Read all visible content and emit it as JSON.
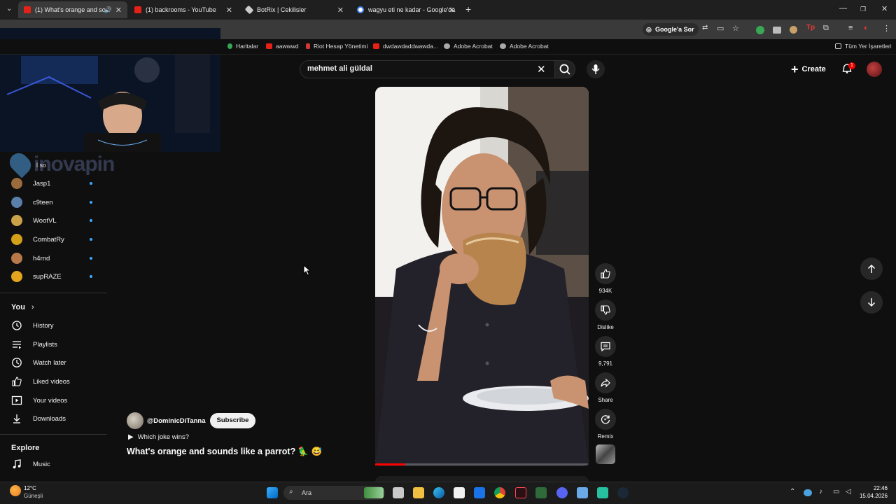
{
  "browser": {
    "tabs": [
      {
        "title": "(1) What's orange and sou",
        "active": true,
        "favicon_color": "#e62117"
      },
      {
        "title": "(1) backrooms - YouTube",
        "active": false,
        "favicon_color": "#e62117"
      },
      {
        "title": "BotRix | Cekilisler",
        "active": false,
        "favicon_color": "#cccccc"
      },
      {
        "title": "wagyu eti ne kadar - Google'da",
        "active": false,
        "favicon_color": "#4285f4"
      }
    ],
    "ask_google_label": "Google'a Sor",
    "bookmarks": [
      {
        "label": "Haritalar",
        "color": "#34a853"
      },
      {
        "label": "aawwwd",
        "color": "#e62117"
      },
      {
        "label": "Riot Hesap Yönetimi",
        "color": "#d13639"
      },
      {
        "label": "dwdawdaddwawda...",
        "color": "#e62117"
      },
      {
        "label": "Adobe Acrobat",
        "color": "#aaaaaa"
      },
      {
        "label": "Adobe Acrobat",
        "color": "#aaaaaa"
      }
    ],
    "all_bookmarks_label": "Tüm Yer İşaretleri"
  },
  "youtube": {
    "search_value": "mehmet ali güldal",
    "create_label": "Create",
    "notification_count": "1"
  },
  "overlay": {
    "watermark_text": "inovapin",
    "clipped_sidebar_text": "l so"
  },
  "sidebar": {
    "subscriptions": [
      {
        "name": "Jasp1",
        "color": "#9c6b3c"
      },
      {
        "name": "c9teen",
        "color": "#5a7fa8"
      },
      {
        "name": "WootVL",
        "color": "#c9a24a"
      },
      {
        "name": "CombatRy",
        "color": "#d4a017"
      },
      {
        "name": "h4rnd",
        "color": "#b8794a"
      },
      {
        "name": "supRAZE",
        "color": "#e3a51d"
      }
    ],
    "you_label": "You",
    "you_items": [
      {
        "label": "History",
        "icon": "history-icon"
      },
      {
        "label": "Playlists",
        "icon": "playlists-icon"
      },
      {
        "label": "Watch later",
        "icon": "watch-later-icon"
      },
      {
        "label": "Liked videos",
        "icon": "liked-videos-icon"
      },
      {
        "label": "Your videos",
        "icon": "your-videos-icon"
      },
      {
        "label": "Downloads",
        "icon": "downloads-icon"
      }
    ],
    "explore_label": "Explore",
    "explore_items": [
      {
        "label": "Music",
        "icon": "music-icon"
      }
    ]
  },
  "short": {
    "channel_handle": "@DominicDiTanna",
    "subscribe_label": "Subscribe",
    "playlist_label": "Which joke wins?",
    "title": "What's orange and sounds like a parrot? 🦜 😅",
    "progress_fraction": 0.14,
    "actions": {
      "like_count": "934K",
      "dislike_label": "Dislike",
      "comment_count": "9,791",
      "share_label": "Share",
      "remix_label": "Remix"
    }
  },
  "taskbar": {
    "weather_temp": "12°C",
    "weather_desc": "Güneşli",
    "search_placeholder": "Ara",
    "time": "22:46",
    "date": "15.04.2026"
  }
}
